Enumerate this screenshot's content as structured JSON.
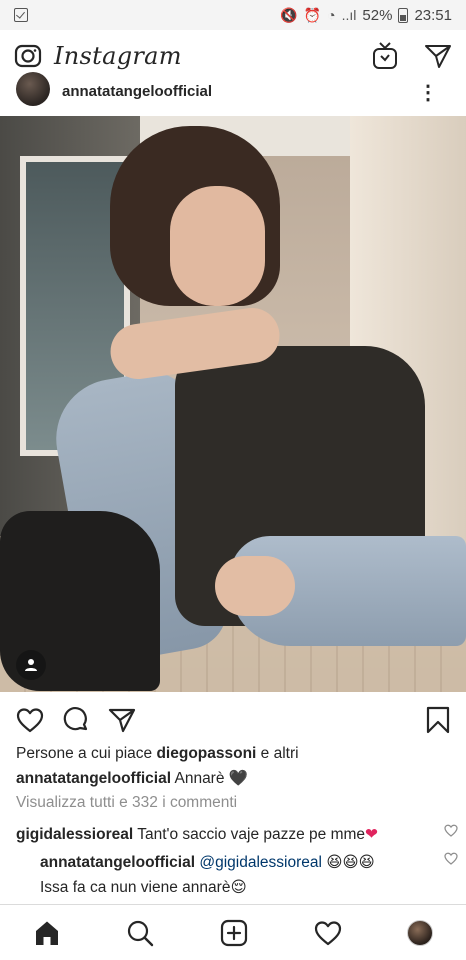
{
  "status_bar": {
    "battery_percent": "52%",
    "time": "23:51",
    "signal_glyph": "..ıl"
  },
  "app_header": {
    "title": "Instagram",
    "camera_icon": "camera-icon",
    "igtv_icon": "igtv-icon",
    "direct_icon": "paper-plane-icon"
  },
  "post": {
    "username": "annatatangeloofficial",
    "more_icon": "more-options-icon",
    "likes": {
      "prefix": "Persone a cui piace",
      "liker": "diegopassoni",
      "suffix": "e altri"
    },
    "caption": {
      "username": "annatatangeloofficial",
      "text": "Annarè",
      "emoji": "🖤"
    },
    "view_comments": "Visualizza tutti e 332 i commenti",
    "comments": [
      {
        "username": "gigidalessioreal",
        "text": "Tant'o saccio vaje pazze pe mme",
        "emoji": "❤"
      },
      {
        "username": "annatatangeloofficial",
        "mention": "@gigidalessioreal",
        "emoji": "😆😆😆",
        "text_line2": "Issa fa ca nun viene annarè",
        "emoji2": "😌"
      }
    ]
  },
  "bottom_nav": {
    "items": [
      "home-icon",
      "search-icon",
      "add-post-icon",
      "activity-heart-icon",
      "profile-icon"
    ]
  }
}
